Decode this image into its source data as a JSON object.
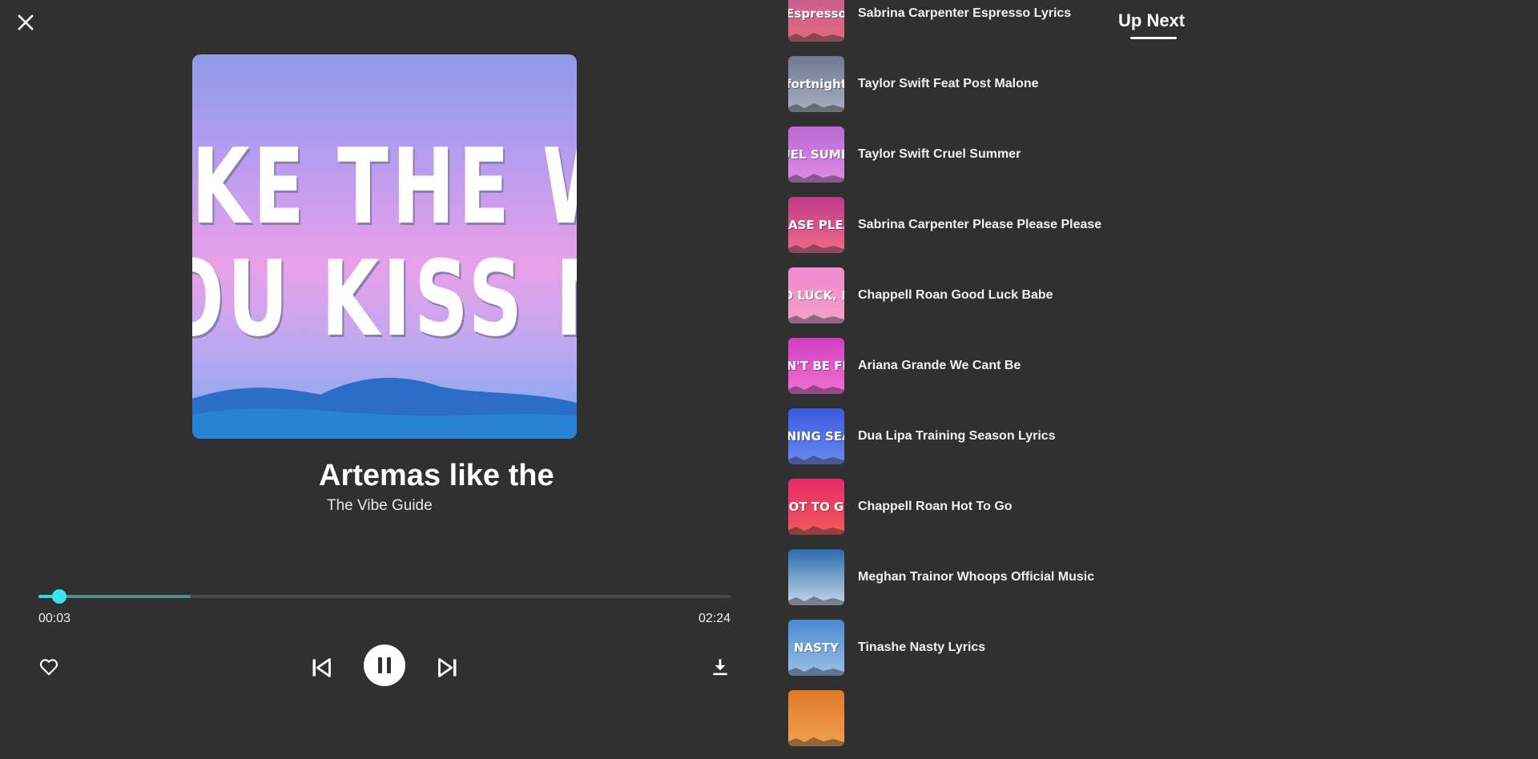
{
  "player": {
    "close_icon": "close-icon",
    "artwork_text": [
      "IKE THE W",
      "OU KISS M"
    ],
    "title": "Artemas like the",
    "artist": "The Vibe Guide",
    "time_current": "00:03",
    "time_total": "02:24",
    "progress_played": 0.03,
    "progress_buffered": 0.22,
    "accent_color": "#3ce4ee",
    "icons": {
      "like": "heart-icon",
      "previous": "skip-previous-icon",
      "play_pause": "pause-icon",
      "next": "skip-next-icon",
      "download": "download-icon"
    }
  },
  "up_next": {
    "title": "Up Next",
    "items": [
      {
        "label": "Sabrina Carpenter Espresso Lyrics",
        "thumb_text": "Espresso",
        "colors": [
          "#c45a9a",
          "#e26a7a"
        ]
      },
      {
        "label": "Taylor Swift Feat Post Malone",
        "thumb_text": "fortnight",
        "colors": [
          "#6f7890",
          "#a8b0c0"
        ]
      },
      {
        "label": "Taylor Swift Cruel Summer",
        "thumb_text": "RUEL SUMME",
        "colors": [
          "#b86ad6",
          "#e08ae0"
        ]
      },
      {
        "label": "Sabrina Carpenter Please Please Please",
        "thumb_text": "EASE PLEA",
        "colors": [
          "#c03a8a",
          "#f06a8a"
        ]
      },
      {
        "label": "Chappell Roan Good Luck Babe",
        "thumb_text": "OD LUCK, BA",
        "colors": [
          "#f08ad0",
          "#f4a0c8"
        ]
      },
      {
        "label": "Ariana Grande We Cant Be",
        "thumb_text": "CAN'T BE FRIE",
        "colors": [
          "#d040c0",
          "#f070d0"
        ]
      },
      {
        "label": "Dua Lipa Training Season Lyrics",
        "thumb_text": "AINING SEAS",
        "colors": [
          "#3a5ae0",
          "#6a8af0"
        ]
      },
      {
        "label": "Chappell Roan Hot To Go",
        "thumb_text": "OT TO G",
        "colors": [
          "#e82a6a",
          "#f05a5a"
        ]
      },
      {
        "label": "Meghan Trainor Whoops Official Music",
        "thumb_text": "",
        "colors": [
          "#2a6ab0",
          "#c8d8e8"
        ]
      },
      {
        "label": "Tinashe Nasty Lyrics",
        "thumb_text": "NASTY",
        "colors": [
          "#4a8ad0",
          "#9ac0e8"
        ]
      },
      {
        "label": "",
        "thumb_text": "",
        "colors": [
          "#e07a2a",
          "#f0a050"
        ]
      }
    ]
  }
}
